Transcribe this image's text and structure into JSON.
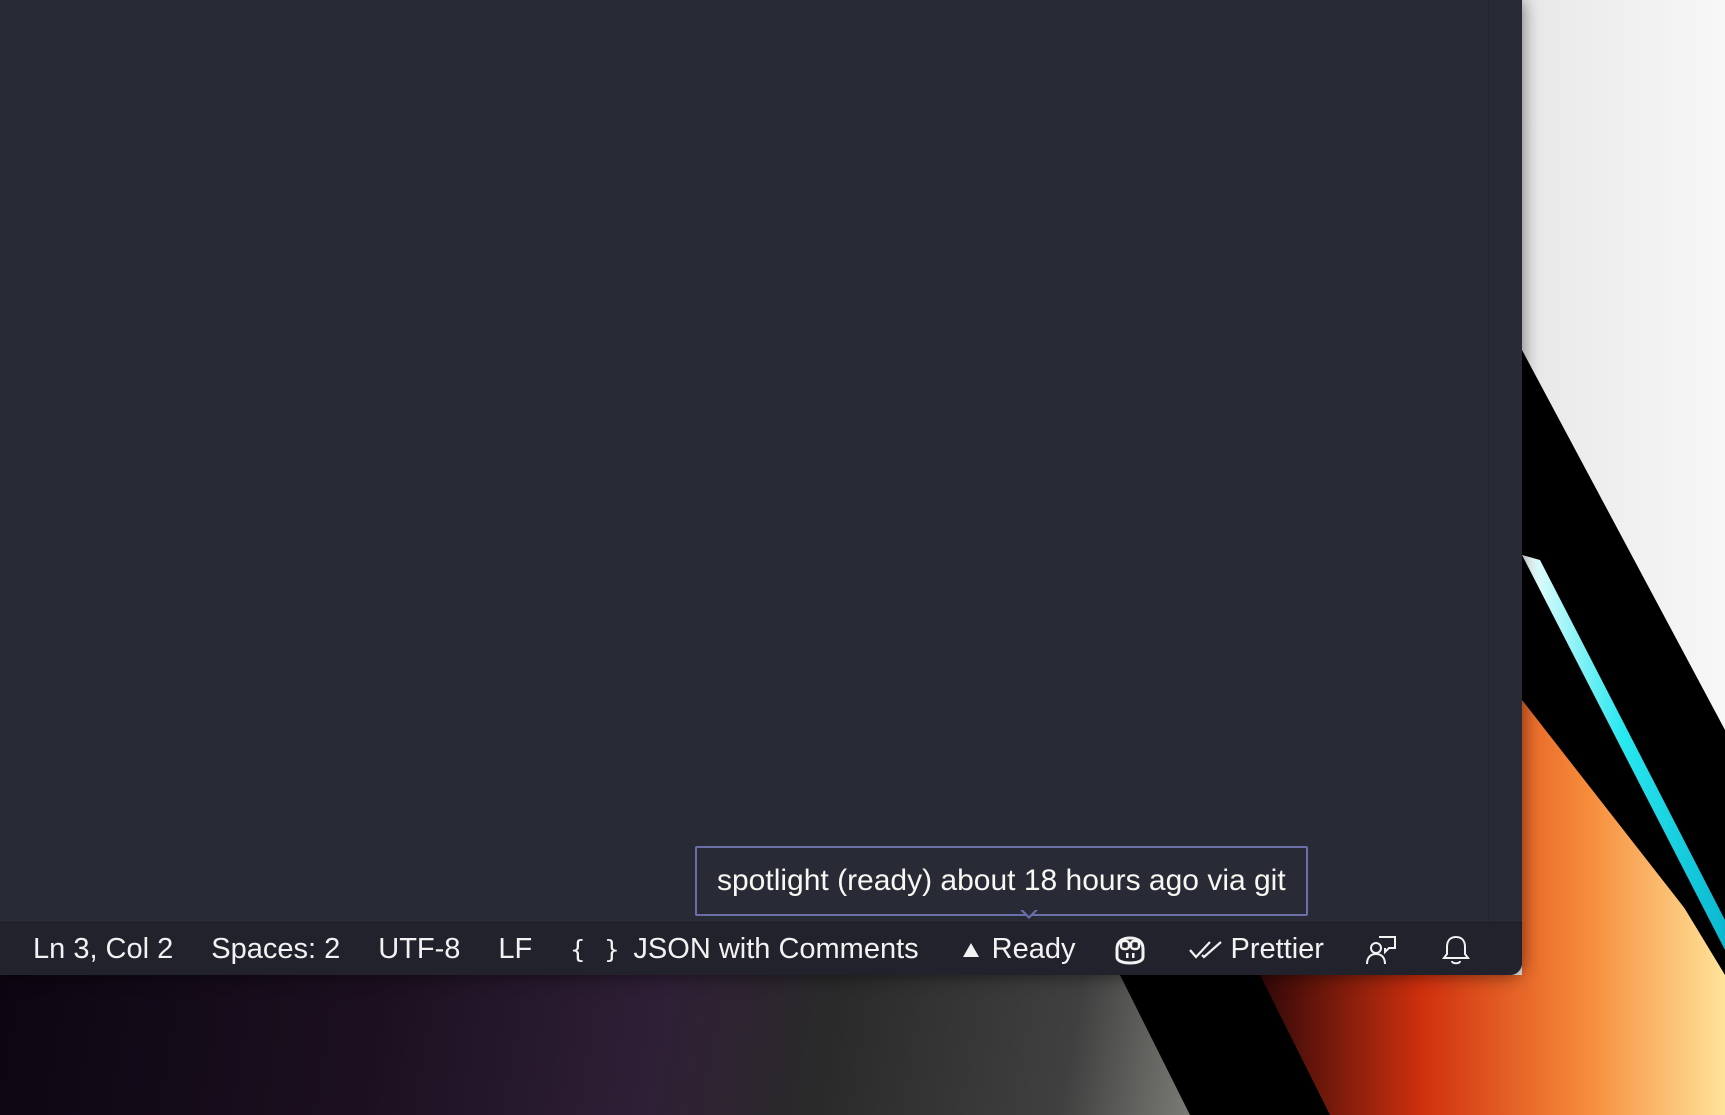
{
  "statusbar": {
    "cursor_position": "Ln 3, Col 2",
    "indentation": "Spaces: 2",
    "encoding": "UTF-8",
    "line_ending": "LF",
    "language_mode": "JSON with Comments",
    "deploy_status": "Ready",
    "formatter": "Prettier"
  },
  "tooltip": {
    "text": "spotlight (ready) about 18 hours ago via git"
  },
  "icons": {
    "language": "braces-icon",
    "deploy": "triangle-up-icon",
    "copilot": "copilot-icon",
    "formatter": "double-check-icon",
    "feedback": "feedback-person-icon",
    "notifications": "bell-icon"
  },
  "colors": {
    "editor_background": "#282a36",
    "statusbar_background": "#21222c",
    "statusbar_text": "#f2f2f2",
    "tooltip_border": "#6b6fa8"
  }
}
